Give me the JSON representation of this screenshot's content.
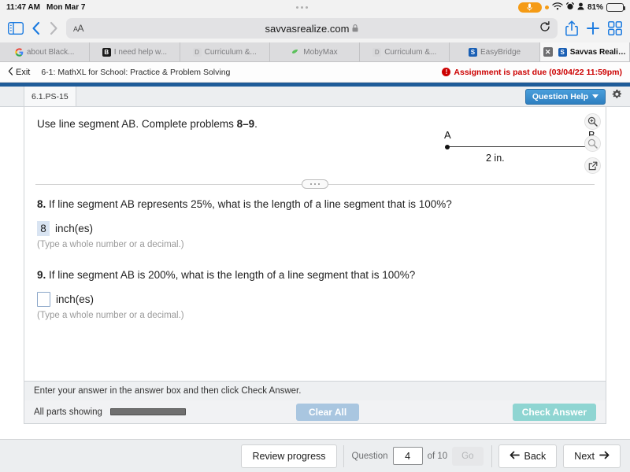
{
  "statusbar": {
    "time": "11:47 AM",
    "date": "Mon Mar 7",
    "battery_pct": "81%",
    "mic_icon": "microphone-icon",
    "wifi_icon": "wifi-icon",
    "alarm_icon": "alarm-icon",
    "person_icon": "person-icon"
  },
  "browser": {
    "sidebar_icon": "sidebar-toggle-icon",
    "back_icon": "back-chevron-icon",
    "forward_icon": "forward-chevron-icon",
    "text_size_label": "AA",
    "url": "savvasrealize.com",
    "lock_icon": "lock-icon",
    "reload_icon": "reload-icon",
    "share_icon": "share-icon",
    "newtab_icon": "plus-icon",
    "tabs_icon": "tabs-overview-icon"
  },
  "tabs": [
    {
      "label": "about Black...",
      "favicon": "google-icon",
      "active": false
    },
    {
      "label": "I need help w...",
      "favicon": "blackboard-icon",
      "active": false
    },
    {
      "label": "Curriculum &...",
      "favicon": "docs-icon",
      "active": false
    },
    {
      "label": "MobyMax",
      "favicon": "mobymax-icon",
      "active": false
    },
    {
      "label": "Curriculum &...",
      "favicon": "docs-icon",
      "active": false
    },
    {
      "label": "EasyBridge",
      "favicon": "savvas-icon",
      "active": false
    },
    {
      "label": "Savvas Realize",
      "favicon": "savvas-icon",
      "active": true
    }
  ],
  "app_header": {
    "exit_label": "Exit",
    "assignment_title": "6-1: MathXL for School: Practice & Problem Solving",
    "past_due_text": "Assignment is past due (03/04/22 11:59pm)",
    "past_due_color": "#cc0000",
    "warning_icon": "exclamation-circle-icon"
  },
  "question_bar": {
    "question_id": "6.1.PS-15",
    "question_help_label": "Question Help",
    "question_help_color": "#2e7fc0",
    "settings_icon": "gear-icon",
    "dropdown_icon": "chevron-down-icon"
  },
  "problem": {
    "prompt_prefix": "Use line segment AB. Complete problems ",
    "prompt_bold": "8–9",
    "prompt_suffix": ".",
    "diagram": {
      "point_a_label": "A",
      "point_b_label": "B",
      "length_label": "2 in."
    },
    "tools": [
      {
        "icon": "zoom-in-icon"
      },
      {
        "icon": "zoom-out-icon"
      },
      {
        "icon": "popout-icon"
      }
    ],
    "divider_handle_icon": "drag-handle-dots-icon",
    "questions": [
      {
        "number": "8.",
        "text": " If line segment AB represents 25%, what is the length of a line segment that is 100%?",
        "answer_value": "8",
        "answer_filled": true,
        "unit": "inch(es)",
        "hint": "(Type a whole number or a decimal.)"
      },
      {
        "number": "9.",
        "text": " If line segment AB is 200%, what is the length of a line segment that is 100%?",
        "answer_value": "",
        "answer_filled": false,
        "unit": "inch(es)",
        "hint": "(Type a whole number or a decimal.)"
      }
    ]
  },
  "status_strip": {
    "message": "Enter your answer in the answer box and then click Check Answer."
  },
  "action_bar": {
    "parts_label": "All parts showing",
    "progress_pct": 100,
    "clear_all_label": "Clear All",
    "clear_all_color": "#a9c6e0",
    "check_answer_label": "Check Answer",
    "check_answer_color": "#8fd5d2"
  },
  "bottom_nav": {
    "review_label": "Review progress",
    "question_label": "Question",
    "question_number": "4",
    "of_label": "of 10",
    "go_label": "Go",
    "back_label": "Back",
    "next_label": "Next",
    "back_icon": "arrow-left-icon",
    "next_icon": "arrow-right-icon"
  }
}
